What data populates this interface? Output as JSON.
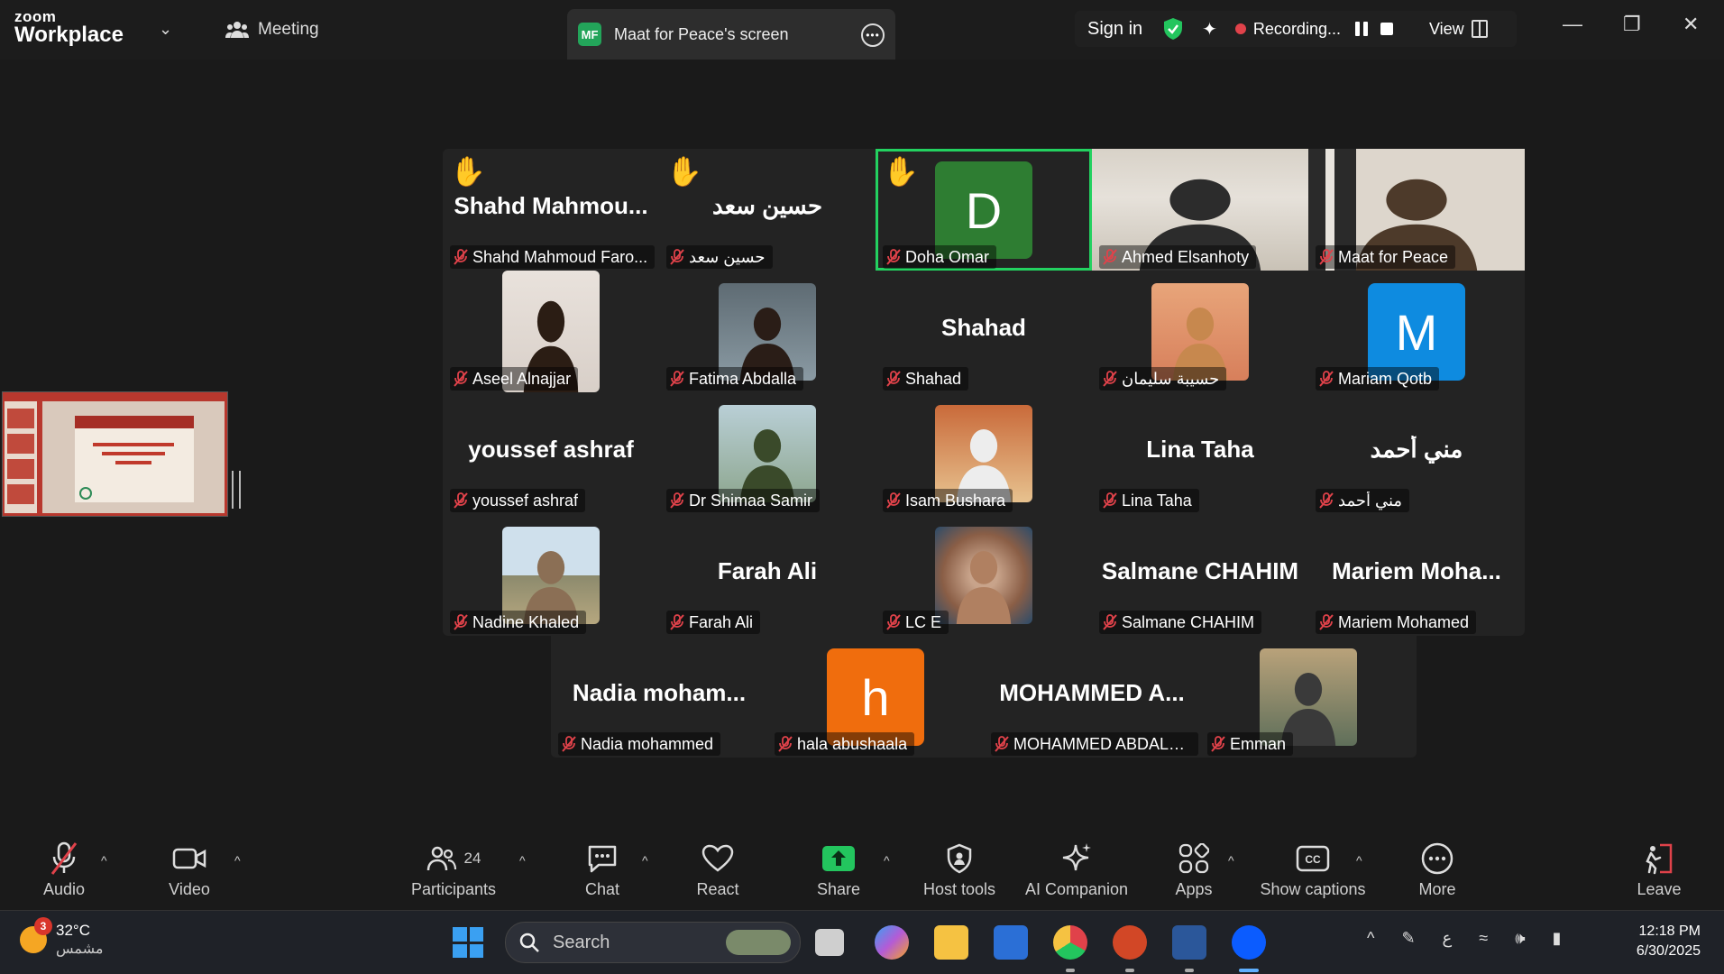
{
  "app": {
    "logo_top": "zoom",
    "logo_bottom": "Workplace",
    "meeting_tab": "Meeting",
    "share_initials": "MF",
    "share_title": "Maat for Peace's screen",
    "sign_in": "Sign in",
    "recording_label": "Recording...",
    "view_label": "View"
  },
  "participants": [
    {
      "name": "Shahd Mahmoud Faro...",
      "big": "Shahd  Mahmou...",
      "hand": true
    },
    {
      "name": "حسين سعد",
      "big": "حسين سعد",
      "hand": true
    },
    {
      "name": "Doha Omar",
      "initial": "D",
      "hand": true,
      "active": true
    },
    {
      "name": "Ahmed Elsanhoty"
    },
    {
      "name": "Maat for Peace"
    },
    {
      "name": "Aseel Alnajjar"
    },
    {
      "name": "Fatima Abdalla"
    },
    {
      "name": "Shahad",
      "big": "Shahad"
    },
    {
      "name": "حسيبة سليمان"
    },
    {
      "name": "Mariam Qotb",
      "initial": "M"
    },
    {
      "name": "youssef ashraf",
      "big": "youssef ashraf"
    },
    {
      "name": "Dr Shimaa Samir"
    },
    {
      "name": "Isam Bushara"
    },
    {
      "name": "Lina Taha",
      "big": "Lina Taha"
    },
    {
      "name": "مني أحمد",
      "big": "مني أحمد"
    },
    {
      "name": "Nadine Khaled"
    },
    {
      "name": "Farah Ali",
      "big": "Farah Ali"
    },
    {
      "name": "LC E"
    },
    {
      "name": "Salmane CHAHIM",
      "big": "Salmane CHAHIM"
    },
    {
      "name": "Mariem Mohamed",
      "big": "Mariem  Moha..."
    },
    {
      "name": "Nadia mohammed",
      "big": "Nadia  moham..."
    },
    {
      "name": "hala abushaala",
      "initial": "h"
    },
    {
      "name": "MOHAMMED ABDALH...",
      "big": "MOHAMMED  A..."
    },
    {
      "name": "Emman"
    }
  ],
  "toolbar": {
    "audio": "Audio",
    "video": "Video",
    "participants": "Participants",
    "participants_count": "24",
    "chat": "Chat",
    "react": "React",
    "share": "Share",
    "host_tools": "Host tools",
    "ai_companion": "AI Companion",
    "apps": "Apps",
    "show_captions": "Show captions",
    "more": "More",
    "leave": "Leave"
  },
  "taskbar": {
    "weather_badge": "3",
    "temperature": "32°C",
    "condition": "مشمس",
    "search_placeholder": "Search",
    "lang": "ع",
    "time": "12:18 PM",
    "date": "6/30/2025"
  },
  "colors": {
    "active_speaker": "#23d160",
    "doha_avatar": "#2e7d32",
    "mariam_avatar": "#0e8be0",
    "hala_avatar": "#f06d0d",
    "share_green": "#23c55e",
    "mic_muted": "#e0424a"
  }
}
